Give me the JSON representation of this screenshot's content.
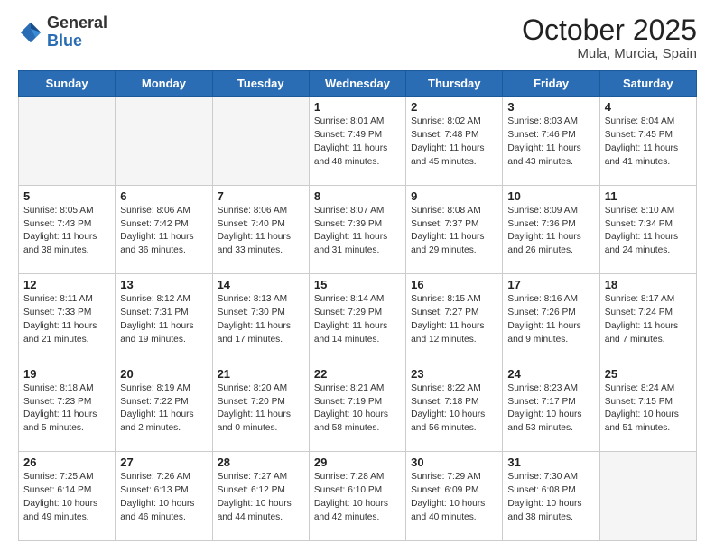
{
  "header": {
    "logo_general": "General",
    "logo_blue": "Blue",
    "month": "October 2025",
    "location": "Mula, Murcia, Spain"
  },
  "weekdays": [
    "Sunday",
    "Monday",
    "Tuesday",
    "Wednesday",
    "Thursday",
    "Friday",
    "Saturday"
  ],
  "weeks": [
    [
      {
        "day": "",
        "info": ""
      },
      {
        "day": "",
        "info": ""
      },
      {
        "day": "",
        "info": ""
      },
      {
        "day": "1",
        "info": "Sunrise: 8:01 AM\nSunset: 7:49 PM\nDaylight: 11 hours\nand 48 minutes."
      },
      {
        "day": "2",
        "info": "Sunrise: 8:02 AM\nSunset: 7:48 PM\nDaylight: 11 hours\nand 45 minutes."
      },
      {
        "day": "3",
        "info": "Sunrise: 8:03 AM\nSunset: 7:46 PM\nDaylight: 11 hours\nand 43 minutes."
      },
      {
        "day": "4",
        "info": "Sunrise: 8:04 AM\nSunset: 7:45 PM\nDaylight: 11 hours\nand 41 minutes."
      }
    ],
    [
      {
        "day": "5",
        "info": "Sunrise: 8:05 AM\nSunset: 7:43 PM\nDaylight: 11 hours\nand 38 minutes."
      },
      {
        "day": "6",
        "info": "Sunrise: 8:06 AM\nSunset: 7:42 PM\nDaylight: 11 hours\nand 36 minutes."
      },
      {
        "day": "7",
        "info": "Sunrise: 8:06 AM\nSunset: 7:40 PM\nDaylight: 11 hours\nand 33 minutes."
      },
      {
        "day": "8",
        "info": "Sunrise: 8:07 AM\nSunset: 7:39 PM\nDaylight: 11 hours\nand 31 minutes."
      },
      {
        "day": "9",
        "info": "Sunrise: 8:08 AM\nSunset: 7:37 PM\nDaylight: 11 hours\nand 29 minutes."
      },
      {
        "day": "10",
        "info": "Sunrise: 8:09 AM\nSunset: 7:36 PM\nDaylight: 11 hours\nand 26 minutes."
      },
      {
        "day": "11",
        "info": "Sunrise: 8:10 AM\nSunset: 7:34 PM\nDaylight: 11 hours\nand 24 minutes."
      }
    ],
    [
      {
        "day": "12",
        "info": "Sunrise: 8:11 AM\nSunset: 7:33 PM\nDaylight: 11 hours\nand 21 minutes."
      },
      {
        "day": "13",
        "info": "Sunrise: 8:12 AM\nSunset: 7:31 PM\nDaylight: 11 hours\nand 19 minutes."
      },
      {
        "day": "14",
        "info": "Sunrise: 8:13 AM\nSunset: 7:30 PM\nDaylight: 11 hours\nand 17 minutes."
      },
      {
        "day": "15",
        "info": "Sunrise: 8:14 AM\nSunset: 7:29 PM\nDaylight: 11 hours\nand 14 minutes."
      },
      {
        "day": "16",
        "info": "Sunrise: 8:15 AM\nSunset: 7:27 PM\nDaylight: 11 hours\nand 12 minutes."
      },
      {
        "day": "17",
        "info": "Sunrise: 8:16 AM\nSunset: 7:26 PM\nDaylight: 11 hours\nand 9 minutes."
      },
      {
        "day": "18",
        "info": "Sunrise: 8:17 AM\nSunset: 7:24 PM\nDaylight: 11 hours\nand 7 minutes."
      }
    ],
    [
      {
        "day": "19",
        "info": "Sunrise: 8:18 AM\nSunset: 7:23 PM\nDaylight: 11 hours\nand 5 minutes."
      },
      {
        "day": "20",
        "info": "Sunrise: 8:19 AM\nSunset: 7:22 PM\nDaylight: 11 hours\nand 2 minutes."
      },
      {
        "day": "21",
        "info": "Sunrise: 8:20 AM\nSunset: 7:20 PM\nDaylight: 11 hours\nand 0 minutes."
      },
      {
        "day": "22",
        "info": "Sunrise: 8:21 AM\nSunset: 7:19 PM\nDaylight: 10 hours\nand 58 minutes."
      },
      {
        "day": "23",
        "info": "Sunrise: 8:22 AM\nSunset: 7:18 PM\nDaylight: 10 hours\nand 56 minutes."
      },
      {
        "day": "24",
        "info": "Sunrise: 8:23 AM\nSunset: 7:17 PM\nDaylight: 10 hours\nand 53 minutes."
      },
      {
        "day": "25",
        "info": "Sunrise: 8:24 AM\nSunset: 7:15 PM\nDaylight: 10 hours\nand 51 minutes."
      }
    ],
    [
      {
        "day": "26",
        "info": "Sunrise: 7:25 AM\nSunset: 6:14 PM\nDaylight: 10 hours\nand 49 minutes."
      },
      {
        "day": "27",
        "info": "Sunrise: 7:26 AM\nSunset: 6:13 PM\nDaylight: 10 hours\nand 46 minutes."
      },
      {
        "day": "28",
        "info": "Sunrise: 7:27 AM\nSunset: 6:12 PM\nDaylight: 10 hours\nand 44 minutes."
      },
      {
        "day": "29",
        "info": "Sunrise: 7:28 AM\nSunset: 6:10 PM\nDaylight: 10 hours\nand 42 minutes."
      },
      {
        "day": "30",
        "info": "Sunrise: 7:29 AM\nSunset: 6:09 PM\nDaylight: 10 hours\nand 40 minutes."
      },
      {
        "day": "31",
        "info": "Sunrise: 7:30 AM\nSunset: 6:08 PM\nDaylight: 10 hours\nand 38 minutes."
      },
      {
        "day": "",
        "info": ""
      }
    ]
  ]
}
